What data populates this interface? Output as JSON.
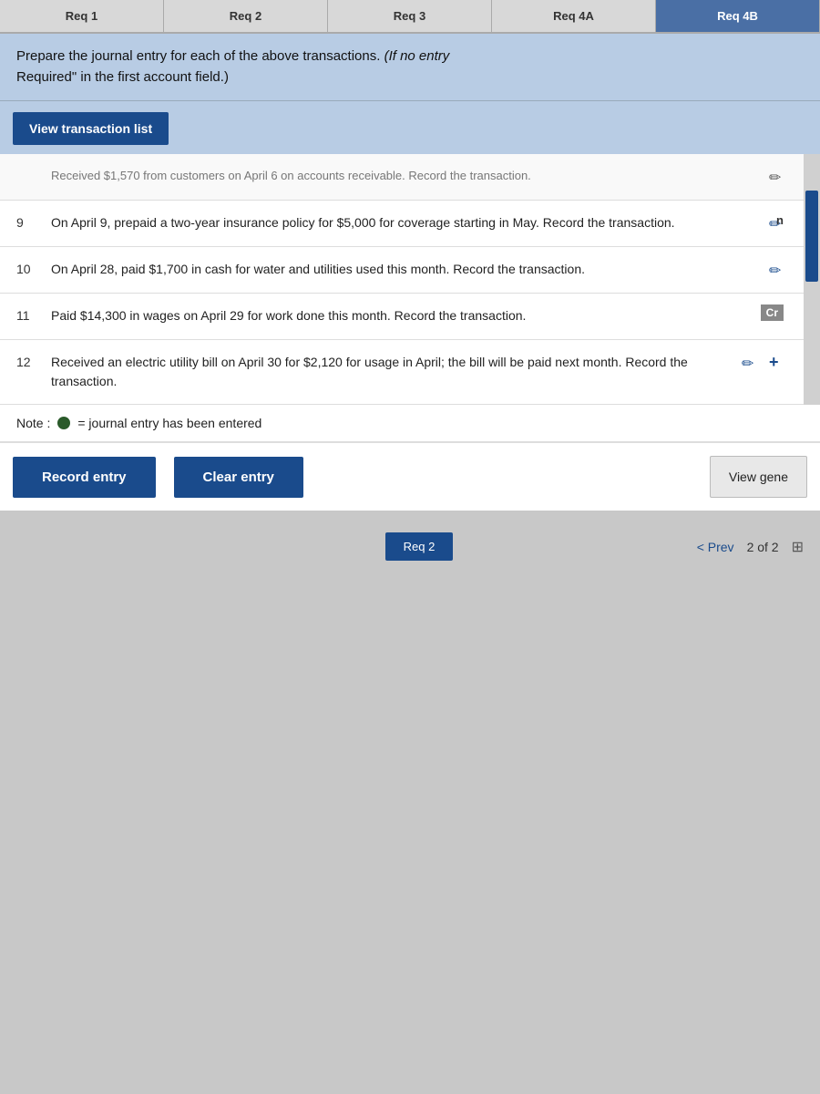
{
  "tabs": [
    {
      "label": "Req 1",
      "active": false
    },
    {
      "label": "Req 2",
      "active": false
    },
    {
      "label": "Req 3",
      "active": false
    },
    {
      "label": "Req 4A",
      "active": false
    },
    {
      "label": "Req 4B",
      "active": true
    }
  ],
  "instruction": {
    "line1": "Prepare the journal entry for each of the above transactions.",
    "italic": "(If no entry",
    "line2": "Required\" in the first account field.)"
  },
  "view_transaction_button": "View transaction list",
  "close_icon": "✕",
  "transactions": [
    {
      "num": "",
      "text": "Received $1,570 from customers on April 6 on accounts receivable. Record the transaction.",
      "faded": true,
      "has_edit": true,
      "edit_blue": false
    },
    {
      "num": "9",
      "text": "On April 9, prepaid a two-year insurance policy for $5,000 for coverage starting in May. Record the transaction.",
      "faded": false,
      "has_edit": true,
      "edit_blue": true
    },
    {
      "num": "10",
      "text": "On April 28, paid $1,700 in cash for water and utilities used this month. Record the transaction.",
      "faded": false,
      "has_edit": true,
      "edit_blue": true
    },
    {
      "num": "11",
      "text": "Paid $14,300 in wages on April 29 for work done this month. Record the transaction.",
      "faded": false,
      "has_edit": true,
      "edit_blue": true,
      "cr_label": "Cr"
    },
    {
      "num": "12",
      "text": "Received an electric utility bill on April 30 for $2,120 for usage in April; the bill will be paid next month. Record the transaction.",
      "faded": false,
      "has_edit": true,
      "edit_blue": true,
      "plus": true
    }
  ],
  "note": {
    "prefix": "Note :",
    "text": "= journal entry has been entered"
  },
  "buttons": {
    "record": "Record entry",
    "clear": "Clear entry",
    "view_general": "View gene"
  },
  "bottom": {
    "req2": "Req 2",
    "prev": "< Prev",
    "page_info": "2 of 2",
    "grid_icon": "⊞"
  },
  "n_label": "n"
}
